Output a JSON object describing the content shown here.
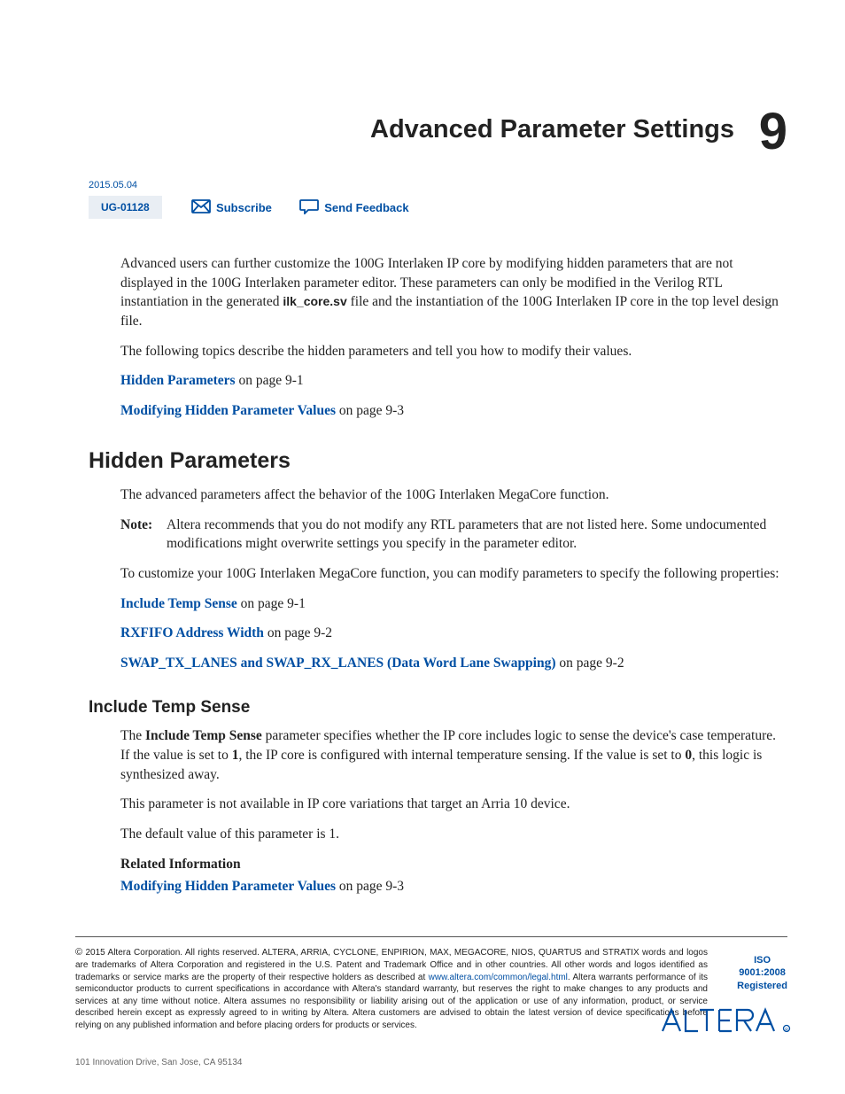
{
  "chapter": {
    "title": "Advanced Parameter Settings",
    "number": "9"
  },
  "meta": {
    "date": "2015.05.04",
    "doc_id": "UG-01128",
    "subscribe_label": "Subscribe",
    "feedback_label": "Send Feedback"
  },
  "intro": {
    "p1_a": "Advanced users can further customize the 100G Interlaken IP core by modifying hidden parameters that are not displayed in the 100G Interlaken parameter editor. These parameters can only be modified in the Verilog RTL instantiation in the generated ",
    "p1_code": "ilk_core.sv",
    "p1_b": " file and the instantiation of the 100G Interlaken IP core in the top level design file.",
    "p2": "The following topics describe the hidden parameters and tell you how to modify their values.",
    "link1_text": "Hidden Parameters",
    "link1_tail": " on page 9-1",
    "link2_text": "Modifying Hidden Parameter Values",
    "link2_tail": " on page 9-3"
  },
  "section1": {
    "heading": "Hidden Parameters",
    "p1": "The advanced parameters affect the behavior of the 100G Interlaken MegaCore function.",
    "note_label": "Note:",
    "note_body": "Altera recommends that you do not modify any RTL parameters that are not listed here. Some undocumented modifications might overwrite settings you specify in the parameter editor.",
    "p2": "To customize your 100G Interlaken MegaCore function, you can modify parameters to specify the following properties:",
    "link1_text": "Include Temp Sense",
    "link1_tail": " on page 9-1",
    "link2_text": "RXFIFO Address Width",
    "link2_tail": " on page 9-2",
    "link3_text": "SWAP_TX_LANES and SWAP_RX_LANES (Data Word Lane Swapping)",
    "link3_tail": " on page 9-2"
  },
  "section2": {
    "heading": "Include Temp Sense",
    "p1_a": "The ",
    "p1_bold1": "Include Temp Sense",
    "p1_b": " parameter specifies whether the IP core includes logic to sense the device's case temperature. If the value is set to ",
    "p1_bold2": "1",
    "p1_c": ", the IP core is configured with internal temperature sensing. If the value is set to ",
    "p1_bold3": "0",
    "p1_d": ", this logic is synthesized away.",
    "p2": "This parameter is not available in IP core variations that target an Arria 10 device.",
    "p3": "The default value of this parameter is 1.",
    "related_label": "Related Information",
    "link_text": "Modifying Hidden Parameter Values",
    "link_tail": " on page 9-3"
  },
  "footer": {
    "copyright_a": "2015 Altera Corporation. All rights reserved. ALTERA, ARRIA, CYCLONE, ENPIRION, MAX, MEGACORE, NIOS, QUARTUS and STRATIX words and logos are trademarks of Altera Corporation and registered in the U.S. Patent and Trademark Office and in other countries. All other words and logos identified as trademarks or service marks are the property of their respective holders as described at ",
    "legal_link": "www.altera.com/common/legal.html",
    "copyright_b": ". Altera warrants performance of its semiconductor products to current specifications in accordance with Altera's standard warranty, but reserves the right to make changes to any products and services at any time without notice. Altera assumes no responsibility or liability arising out of the application or use of any information, product, or service described herein except as expressly agreed to in writing by Altera. Altera customers are advised to obtain the latest version of device specifications before relying on any published information and before placing orders for products or services.",
    "copyright_sym": "©",
    "iso_line1": "ISO",
    "iso_line2": "9001:2008",
    "iso_line3": "Registered",
    "address": "101 Innovation Drive, San Jose, CA 95134"
  }
}
